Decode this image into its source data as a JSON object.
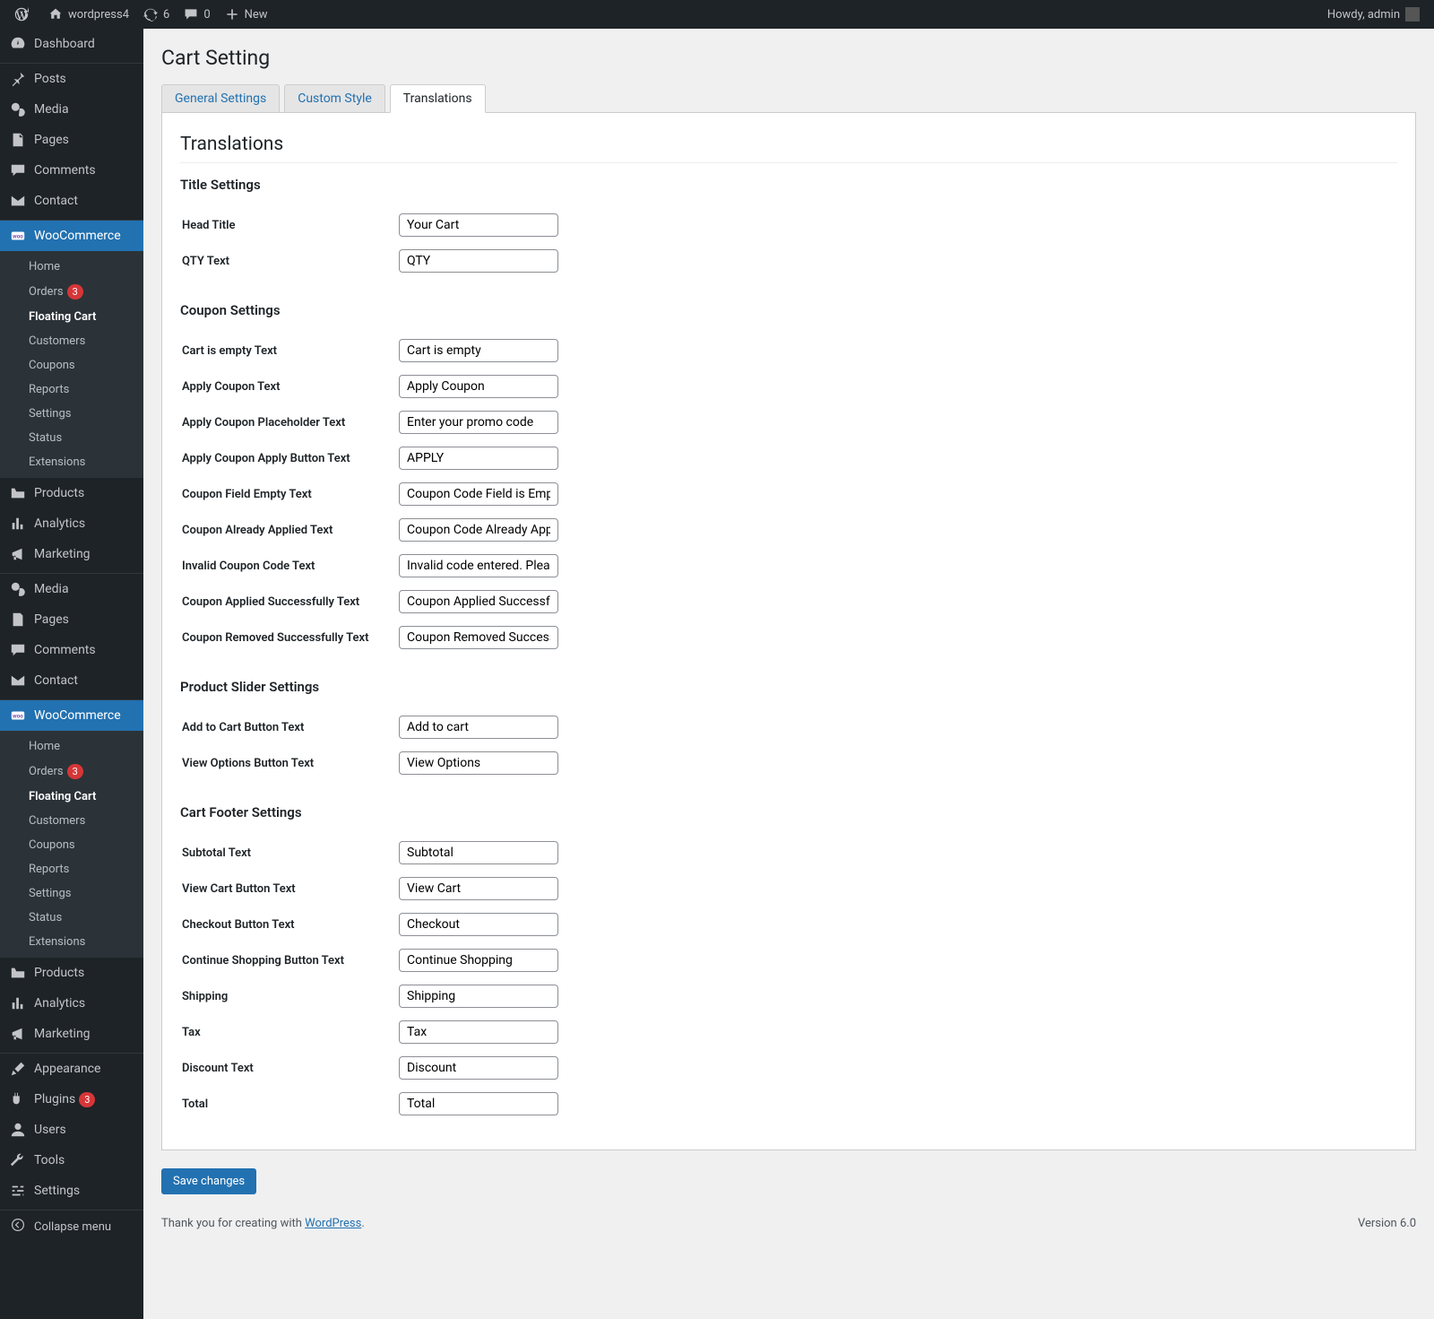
{
  "adminbar": {
    "site": "wordpress4",
    "updates": "6",
    "comments": "0",
    "new": "New",
    "howdy": "Howdy, admin"
  },
  "sidebar": {
    "dashboard": "Dashboard",
    "posts": "Posts",
    "media": "Media",
    "pages": "Pages",
    "comments": "Comments",
    "contact": "Contact",
    "woocommerce": "WooCommerce",
    "woo_sub": {
      "home": "Home",
      "orders": "Orders",
      "orders_badge": "3",
      "floating_cart": "Floating Cart",
      "customers": "Customers",
      "coupons": "Coupons",
      "reports": "Reports",
      "settings": "Settings",
      "status": "Status",
      "extensions": "Extensions"
    },
    "products": "Products",
    "analytics": "Analytics",
    "marketing": "Marketing",
    "media2": "Media",
    "pages2": "Pages",
    "comments2": "Comments",
    "contact2": "Contact",
    "woocommerce2": "WooCommerce",
    "products2": "Products",
    "analytics2": "Analytics",
    "marketing2": "Marketing",
    "appearance": "Appearance",
    "plugins": "Plugins",
    "plugins_badge": "3",
    "users": "Users",
    "tools": "Tools",
    "settings_m": "Settings",
    "collapse": "Collapse menu"
  },
  "page": {
    "title": "Cart Setting",
    "tabs": {
      "general": "General Settings",
      "style": "Custom Style",
      "translations": "Translations"
    },
    "heading": "Translations"
  },
  "sections": {
    "title": "Title Settings",
    "coupon": "Coupon Settings",
    "slider": "Product Slider Settings",
    "footer": "Cart Footer Settings"
  },
  "fields": {
    "head_title": {
      "label": "Head Title",
      "value": "Your Cart"
    },
    "qty_text": {
      "label": "QTY Text",
      "value": "QTY"
    },
    "cart_empty": {
      "label": "Cart is empty Text",
      "value": "Cart is empty"
    },
    "apply_coupon": {
      "label": "Apply Coupon Text",
      "value": "Apply Coupon"
    },
    "apply_coupon_ph": {
      "label": "Apply Coupon Placeholder Text",
      "value": "Enter your promo code"
    },
    "apply_coupon_btn": {
      "label": "Apply Coupon Apply Button Text",
      "value": "APPLY"
    },
    "coupon_empty": {
      "label": "Coupon Field Empty Text",
      "value": "Coupon Code Field is Empty"
    },
    "coupon_already": {
      "label": "Coupon Already Applied Text",
      "value": "Coupon Code Already Applied"
    },
    "invalid_coupon": {
      "label": "Invalid Coupon Code Text",
      "value": "Invalid code entered. Please try again"
    },
    "coupon_applied": {
      "label": "Coupon Applied Successfully Text",
      "value": "Coupon Applied Successfully"
    },
    "coupon_removed": {
      "label": "Coupon Removed Successfully Text",
      "value": "Coupon Removed Successfully"
    },
    "add_to_cart": {
      "label": "Add to Cart Button Text",
      "value": "Add to cart"
    },
    "view_options": {
      "label": "View Options Button Text",
      "value": "View Options"
    },
    "subtotal": {
      "label": "Subtotal Text",
      "value": "Subtotal"
    },
    "view_cart": {
      "label": "View Cart Button Text",
      "value": "View Cart"
    },
    "checkout": {
      "label": "Checkout Button Text",
      "value": "Checkout"
    },
    "continue": {
      "label": "Continue Shopping Button Text",
      "value": "Continue Shopping"
    },
    "shipping": {
      "label": "Shipping",
      "value": "Shipping"
    },
    "tax": {
      "label": "Tax",
      "value": "Tax"
    },
    "discount": {
      "label": "Discount Text",
      "value": "Discount"
    },
    "total": {
      "label": "Total",
      "value": "Total"
    }
  },
  "save": "Save changes",
  "footer": {
    "thank": "Thank you for creating with ",
    "wp": "WordPress",
    "dot": ".",
    "version": "Version 6.0"
  }
}
